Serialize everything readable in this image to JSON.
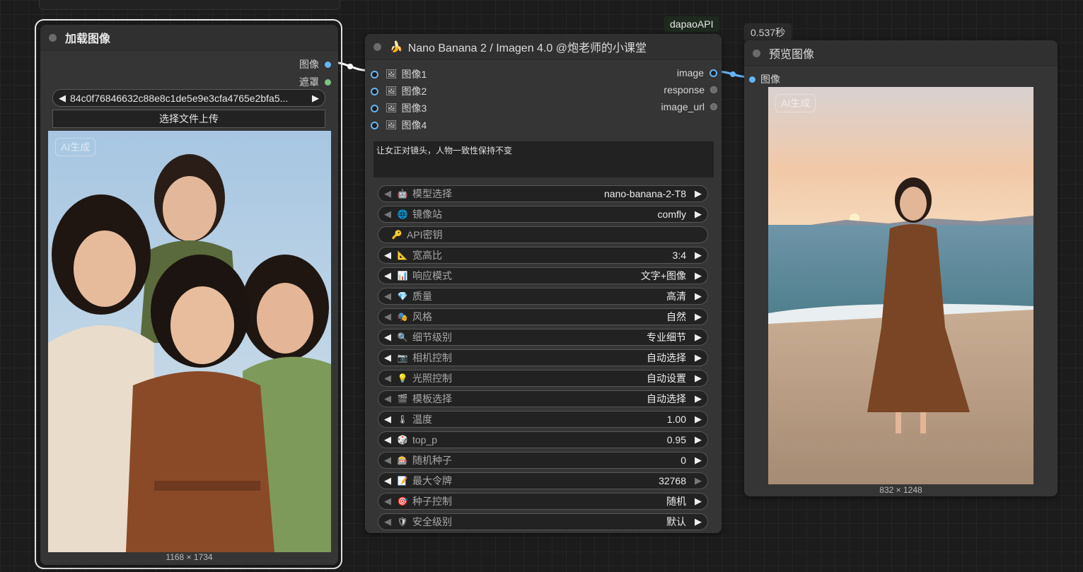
{
  "load_node": {
    "title": "加载图像",
    "outputs": [
      {
        "label": "图像",
        "color": "#64b5f6"
      },
      {
        "label": "遮罩",
        "color": "#7bc47b"
      }
    ],
    "filename": "84c0f76846632c88e8c1de5e9e3cfa4765e2bfa5...",
    "upload_label": "选择文件上传",
    "image_watermark": "AI生成",
    "image_dims": "1168 × 1734"
  },
  "nano_node": {
    "badge": "dapaoAPI",
    "title": "Nano Banana 2 / Imagen 4.0 @炮老师的小课堂",
    "title_icon": "banana-icon",
    "inputs": [
      {
        "label": "图像1",
        "icon": "picture-icon"
      },
      {
        "label": "图像2",
        "icon": "picture-icon"
      },
      {
        "label": "图像3",
        "icon": "picture-icon"
      },
      {
        "label": "图像4",
        "icon": "picture-icon"
      }
    ],
    "outputs": [
      {
        "label": "image",
        "connected": true
      },
      {
        "label": "response",
        "connected": false
      },
      {
        "label": "image_url",
        "connected": false
      }
    ],
    "prompt": "让女正对镜头，人物一致性保持不变",
    "widgets": [
      {
        "name": "model-select",
        "icon": "🤖",
        "label": "模型选择",
        "value": "nano-banana-2-T8"
      },
      {
        "name": "mirror-site",
        "icon": "🌐",
        "label": "镜像站",
        "value": "comfly"
      },
      {
        "name": "api-key",
        "icon": "🔑",
        "label": "API密钥",
        "value": ""
      },
      {
        "name": "aspect-ratio",
        "icon": "📐",
        "label": "宽高比",
        "value": "3:4"
      },
      {
        "name": "response-mode",
        "icon": "📊",
        "label": "响应模式",
        "value": "文字+图像"
      },
      {
        "name": "quality",
        "icon": "💎",
        "label": "质量",
        "value": "高清"
      },
      {
        "name": "style",
        "icon": "🎭",
        "label": "风格",
        "value": "自然"
      },
      {
        "name": "detail-level",
        "icon": "🔍",
        "label": "细节级别",
        "value": "专业细节"
      },
      {
        "name": "camera-control",
        "icon": "📷",
        "label": "相机控制",
        "value": "自动选择"
      },
      {
        "name": "lighting-control",
        "icon": "💡",
        "label": "光照控制",
        "value": "自动设置"
      },
      {
        "name": "template-select",
        "icon": "🎬",
        "label": "模板选择",
        "value": "自动选择"
      },
      {
        "name": "temperature",
        "icon": "🌡",
        "label": "温度",
        "value": "1.00"
      },
      {
        "name": "top-p",
        "icon": "🎲",
        "label": "top_p",
        "value": "0.95"
      },
      {
        "name": "random-seed",
        "icon": "🎰",
        "label": "随机种子",
        "value": "0"
      },
      {
        "name": "max-tokens",
        "icon": "📝",
        "label": "最大令牌",
        "value": "32768"
      },
      {
        "name": "seed-control",
        "icon": "🎯",
        "label": "种子控制",
        "value": "随机"
      },
      {
        "name": "safety-level",
        "icon": "🛡",
        "label": "安全级别",
        "value": "默认"
      }
    ]
  },
  "preview_node": {
    "time_badge": "0.537秒",
    "title": "预览图像",
    "input_label": "图像",
    "image_watermark": "AI生成",
    "image_dims": "832 × 1248"
  },
  "colors": {
    "canvas_bg": "#1c1c1c",
    "node_bg": "#353535",
    "image_socket": "#64b5f6",
    "mask_socket": "#7bc47b",
    "wire": "#ffffff",
    "wire_out": "#64b5f6"
  }
}
